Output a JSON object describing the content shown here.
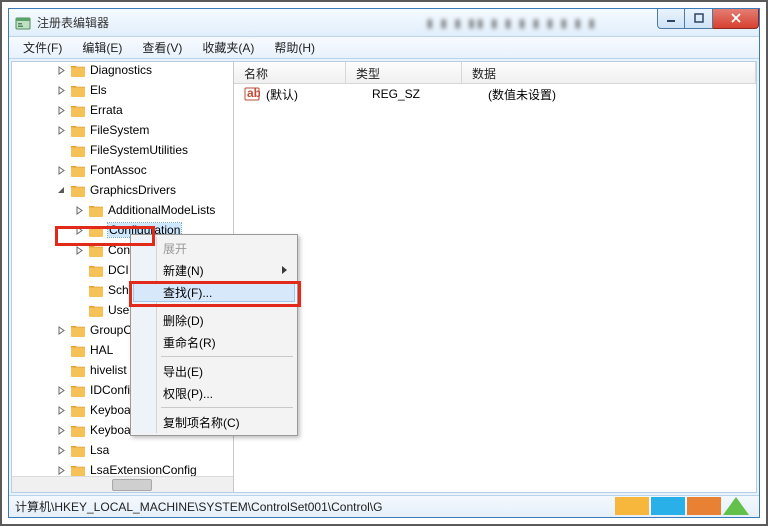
{
  "window": {
    "title": "注册表编辑器"
  },
  "menu": [
    "文件(F)",
    "编辑(E)",
    "查看(V)",
    "收藏夹(A)",
    "帮助(H)"
  ],
  "tree": {
    "l1": [
      {
        "label": "Diagnostics",
        "exp": "closed"
      },
      {
        "label": "Els",
        "exp": "closed"
      },
      {
        "label": "Errata",
        "exp": "closed"
      },
      {
        "label": "FileSystem",
        "exp": "closed"
      },
      {
        "label": "FileSystemUtilities",
        "exp": "none"
      },
      {
        "label": "FontAssoc",
        "exp": "closed"
      }
    ],
    "graphics": {
      "label": "GraphicsDrivers",
      "exp": "open"
    },
    "children": [
      {
        "label": "AdditionalModeLists",
        "exp": "closed"
      },
      {
        "label": "Configuration",
        "exp": "closed",
        "selected": true
      },
      {
        "label": "Conn",
        "exp": "closed",
        "cut": true
      },
      {
        "label": "DCI",
        "exp": "none",
        "cut": true
      },
      {
        "label": "Sched",
        "exp": "none",
        "cut": true
      },
      {
        "label": "UseN",
        "exp": "none",
        "cut": true
      }
    ],
    "l1b": [
      {
        "label": "GroupOr",
        "exp": "closed",
        "cut": true
      },
      {
        "label": "HAL",
        "exp": "none",
        "cut": true
      },
      {
        "label": "hivelist",
        "exp": "none",
        "cut": true
      },
      {
        "label": "IDConfig",
        "exp": "closed",
        "cut": true
      },
      {
        "label": "Keyboar",
        "exp": "closed",
        "cut": true
      },
      {
        "label": "Keyboar",
        "exp": "closed",
        "cut": true
      },
      {
        "label": "Lsa",
        "exp": "closed"
      },
      {
        "label": "LsaExtensionConfig",
        "exp": "closed"
      }
    ]
  },
  "list": {
    "headers": {
      "name": "名称",
      "type": "类型",
      "data": "数据"
    },
    "rows": [
      {
        "name": "(默认)",
        "type": "REG_SZ",
        "data": "(数值未设置)"
      }
    ]
  },
  "ctx": {
    "items": [
      {
        "label": "展开",
        "kind": "disabled"
      },
      {
        "label": "新建(N)",
        "kind": "sub"
      },
      {
        "label": "查找(F)...",
        "kind": "hover"
      },
      {
        "sep": true
      },
      {
        "label": "删除(D)"
      },
      {
        "label": "重命名(R)"
      },
      {
        "sep": true
      },
      {
        "label": "导出(E)"
      },
      {
        "label": "权限(P)..."
      },
      {
        "sep": true
      },
      {
        "label": "复制项名称(C)"
      }
    ]
  },
  "status": {
    "path": "计算机\\HKEY_LOCAL_MACHINE\\SYSTEM\\ControlSet001\\Control\\G"
  }
}
